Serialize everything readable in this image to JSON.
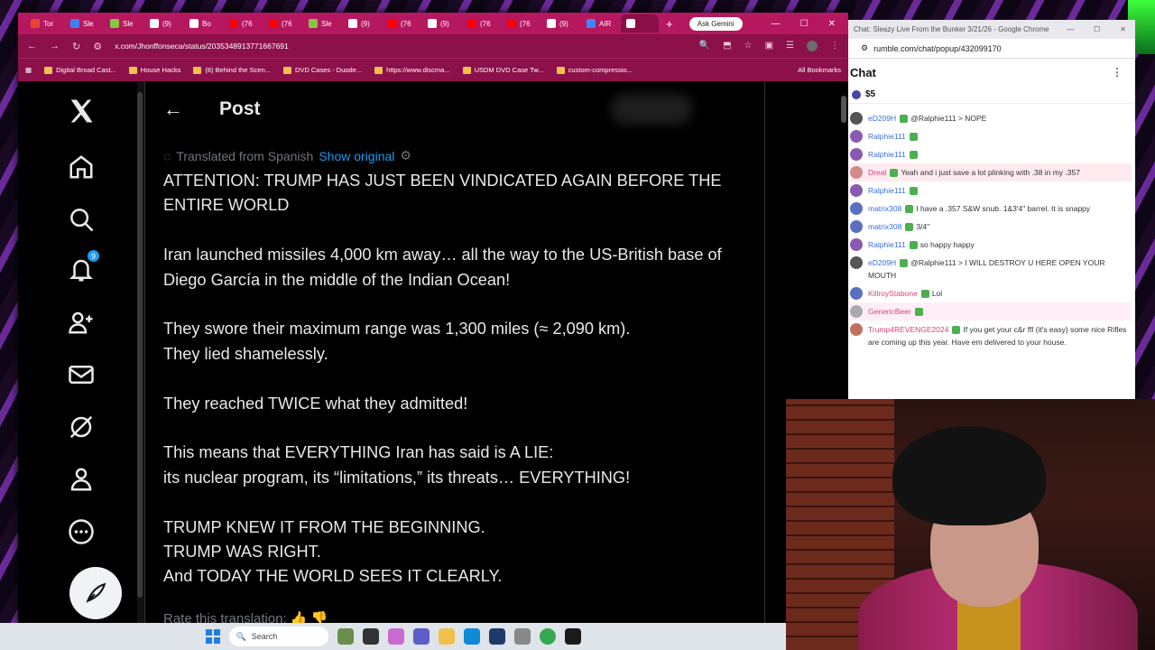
{
  "browser": {
    "tabs": [
      {
        "label": "Tor",
        "color": "#ea4335"
      },
      {
        "label": "Sle",
        "color": "#3b82f6"
      },
      {
        "label": "Sle",
        "color": "#85c742"
      },
      {
        "label": "(9)",
        "color": "#ffffff"
      },
      {
        "label": "Bo",
        "color": "#ffffff"
      },
      {
        "label": "(76",
        "color": "#ff0000"
      },
      {
        "label": "(76",
        "color": "#ff0000"
      },
      {
        "label": "Sle",
        "color": "#85c742"
      },
      {
        "label": "(9)",
        "color": "#ffffff"
      },
      {
        "label": "(76",
        "color": "#ff0000"
      },
      {
        "label": "(9)",
        "color": "#ffffff"
      },
      {
        "label": "(76",
        "color": "#ff0000"
      },
      {
        "label": "(76",
        "color": "#ff0000"
      },
      {
        "label": "(9)",
        "color": "#ffffff"
      },
      {
        "label": "AIR",
        "color": "#4285f4"
      },
      {
        "label": "",
        "color": "#ffffff"
      }
    ],
    "ask_gemini": "Ask Gemini",
    "url": "x.com/Jhonffonseca/status/2035348913771667691",
    "bookmarks": [
      "Digital Broad Cast...",
      "House Hacks",
      "(8) Behind the Scen...",
      "DVD Cases - Duode...",
      "https://www.discma...",
      "USDM DVD Case Tw...",
      "custom-compressio..."
    ],
    "all_bookmarks": "All Bookmarks"
  },
  "x": {
    "notif_count": "9",
    "header_title": "Post",
    "translated_from": "Translated from Spanish",
    "show_original": "Show original",
    "paragraphs": [
      "ATTENTION: TRUMP HAS JUST BEEN VINDICATED AGAIN BEFORE THE ENTIRE WORLD",
      "Iran launched missiles 4,000 km away… all the way to the US-British base of Diego García in the middle of the Indian Ocean!",
      "They swore their maximum range was 1,300 miles (≈ 2,090 km).\nThey lied shamelessly.",
      "They reached TWICE what they admitted!",
      "This means that EVERYTHING Iran has said is A LIE:\nits nuclear program, its “limitations,” its threats… EVERYTHING!",
      "TRUMP KNEW IT FROM THE BEGINNING.\nTRUMP WAS RIGHT.\nAnd TODAY THE WORLD SEES IT CLEARLY."
    ],
    "rate_translation": "Rate this translation"
  },
  "chat": {
    "window_title": "Chat: Sleazy Live From the Bunker 3/21/26 - Google Chrome",
    "url": "rumble.com/chat/popup/432099170",
    "heading": "Chat",
    "donation": "$5",
    "messages": [
      {
        "user": "eD209H",
        "color": "#3a6fd8",
        "text": "@Ralphie111 > NOPE",
        "avatar": "#555555",
        "hl": ""
      },
      {
        "user": "Ralphie111",
        "color": "#3a6fd8",
        "text": "",
        "avatar": "#8a5ab0",
        "hl": ""
      },
      {
        "user": "Ralphie111",
        "color": "#3a6fd8",
        "text": "",
        "avatar": "#8a5ab0",
        "hl": ""
      },
      {
        "user": "Dreal",
        "color": "#e0407a",
        "text": "Yeah and i just save a lot plinking with .38 in my .357",
        "avatar": "#d08a8a",
        "hl": "hl"
      },
      {
        "user": "Ralphie111",
        "color": "#3a6fd8",
        "text": "",
        "avatar": "#8a5ab0",
        "hl": ""
      },
      {
        "user": "matrix308",
        "color": "#3a6fd8",
        "text": "I have a .357 S&W snub. 1&3'4\" barrel. It is snappy",
        "avatar": "#5a6fc0",
        "hl": ""
      },
      {
        "user": "matrix308",
        "color": "#3a6fd8",
        "text": "3/4\"",
        "avatar": "#5a6fc0",
        "hl": ""
      },
      {
        "user": "Ralphie111",
        "color": "#3a6fd8",
        "text": "so happy happy",
        "avatar": "#8a5ab0",
        "hl": ""
      },
      {
        "user": "eD209H",
        "color": "#3a6fd8",
        "text": "@Ralphie111 > I WILL DESTROY U HERE OPEN YOUR MOUTH",
        "avatar": "#555555",
        "hl": ""
      },
      {
        "user": "KillroyStabone",
        "color": "#e0407a",
        "text": "Lol",
        "avatar": "#5a6fc0",
        "hl": ""
      },
      {
        "user": "GenericBeer",
        "color": "#e0407a",
        "text": "",
        "avatar": "#aaaaaa",
        "hl": "hl2"
      },
      {
        "user": "Trump4REVENGE2024",
        "color": "#e0407a",
        "text": "If you get your c&r ffl (it's easy) some nice Rifles are coming up this year. Have em delivered to your house.",
        "avatar": "#c07060",
        "hl": ""
      }
    ]
  },
  "taskbar": {
    "search": "Search"
  }
}
